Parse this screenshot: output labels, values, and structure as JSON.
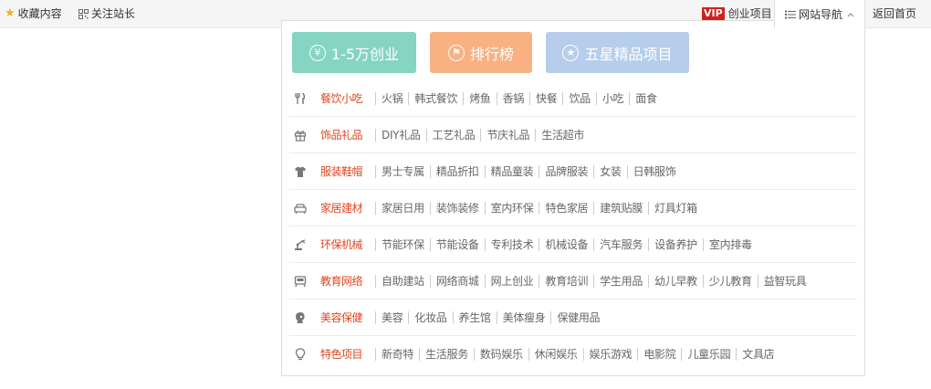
{
  "topbar": {
    "favorite": "收藏内容",
    "follow": "关注站长",
    "vip_badge": "VIP",
    "vip_label": "创业项目",
    "nav_label": "网站导航",
    "home_label": "返回首页"
  },
  "dropdown": {
    "buttons": [
      {
        "icon": "¥",
        "label": "1-5万创业",
        "color": "#86d4c2"
      },
      {
        "icon": "⚑",
        "label": "排行榜",
        "color": "#f9b183"
      },
      {
        "icon": "★",
        "label": "五星精品项目",
        "color": "#b6cdeb"
      }
    ],
    "categories": [
      {
        "icon": "fork-knife-icon",
        "title": "餐饮小吃",
        "links": [
          "火锅",
          "韩式餐饮",
          "烤鱼",
          "香锅",
          "快餐",
          "饮品",
          "小吃",
          "面食"
        ]
      },
      {
        "icon": "gift-icon",
        "title": "饰品礼品",
        "links": [
          "DIY礼品",
          "工艺礼品",
          "节庆礼品",
          "生活超市"
        ]
      },
      {
        "icon": "tshirt-icon",
        "title": "服装鞋帽",
        "links": [
          "男士专属",
          "精品折扣",
          "精品童装",
          "品牌服装",
          "女装",
          "日韩服饰"
        ]
      },
      {
        "icon": "sofa-icon",
        "title": "家居建材",
        "links": [
          "家居日用",
          "装饰装修",
          "室内环保",
          "特色家居",
          "建筑贴膜",
          "灯具灯箱"
        ]
      },
      {
        "icon": "machine-arm-icon",
        "title": "环保机械",
        "links": [
          "节能环保",
          "节能设备",
          "专利技术",
          "机械设备",
          "汽车服务",
          "设备养护",
          "室内排毒"
        ]
      },
      {
        "icon": "education-icon",
        "title": "教育网络",
        "links": [
          "自助建站",
          "网络商城",
          "网上创业",
          "教育培训",
          "学生用品",
          "幼儿早教",
          "少儿教育",
          "益智玩具"
        ]
      },
      {
        "icon": "beauty-icon",
        "title": "美容保健",
        "links": [
          "美容",
          "化妆品",
          "养生馆",
          "美体瘦身",
          "保健用品"
        ]
      },
      {
        "icon": "lightbulb-icon",
        "title": "特色项目",
        "links": [
          "新奇特",
          "生活服务",
          "数码娱乐",
          "休闲娱乐",
          "娱乐游戏",
          "电影院",
          "儿童乐园",
          "文具店"
        ]
      }
    ]
  },
  "colors": {
    "category_title": "#e0461f",
    "link": "#666666",
    "vip": "#d0211c"
  }
}
